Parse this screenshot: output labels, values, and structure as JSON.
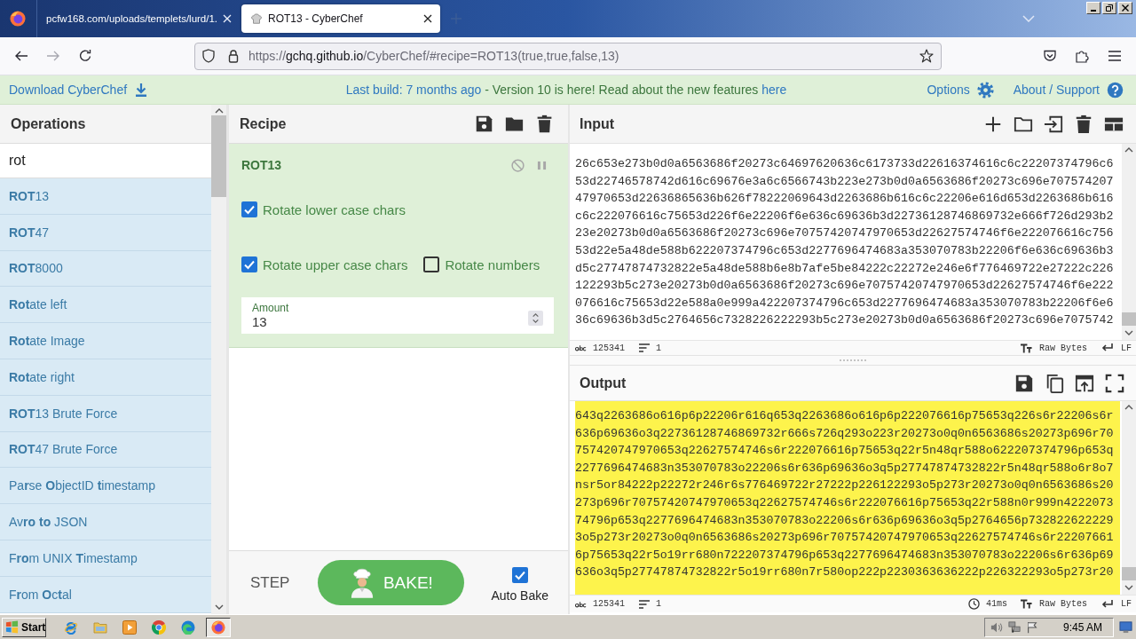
{
  "browser": {
    "tabs": [
      {
        "title": "pcfw168.com/uploads/templets/lurd/1.",
        "selected": false
      },
      {
        "title": "ROT13 - CyberChef",
        "selected": true
      }
    ],
    "url": {
      "scheme": "https://",
      "host": "gchq.github.io",
      "path": "/CyberChef/#recipe=ROT13(true,true,false,13)"
    }
  },
  "banner": {
    "download": "Download CyberChef",
    "build_link": "Last build: 7 months ago",
    "notice": "- Version 10 is here! Read about the new features",
    "notice_link": "here",
    "options": "Options",
    "about": "About / Support"
  },
  "operations": {
    "title": "Operations",
    "search": "rot",
    "items": [
      "**ROT**13",
      "**ROT**47",
      "**ROT**8000",
      "**Rot**ate left",
      "**Rot**ate Image",
      "**Rot**ate right",
      "**ROT**13 Brute Force",
      "**ROT**47 Brute Force",
      "Pa**r**se **O**bjectID **t**imestamp",
      "Av**ro** **to** JSON",
      "F**ro**m UNIX **T**imestamp",
      "F**r**om **O**c**t**al"
    ]
  },
  "recipe": {
    "title": "Recipe",
    "operation": {
      "name": "ROT13",
      "args": [
        {
          "kind": "checkbox",
          "label": "Rotate lower case chars",
          "checked": true
        },
        {
          "kind": "checkbox",
          "label": "Rotate upper case chars",
          "checked": true
        },
        {
          "kind": "checkbox",
          "label": "Rotate numbers",
          "checked": false
        },
        {
          "kind": "number",
          "label": "Amount",
          "value": "13"
        }
      ]
    },
    "step": "STEP",
    "bake": "BAKE!",
    "auto_bake": {
      "label": "Auto Bake",
      "checked": true
    }
  },
  "input": {
    "title": "Input",
    "lines": [
      "26c653e273b0d0a6563686f20273c64697620636c6173733d22616374616c6c22207374796c6",
      "53d22746578742d616c69676e3a6c6566743b223e273b0d0a6563686f20273c696e707574207",
      "47970653d22636865636b626f78222069643d2263686b616c6c22206e616d653d2263686b616",
      "c6c222076616c75653d226f6e22206f6e636c69636b3d22736128746869732e666f726d293b2",
      "23e20273b0d0a6563686f20273c696e70757420747970653d22627574746f6e222076616c756",
      "53d22e5a48de588b622207374796c653d2277696474683a353070783b22206f6e636c69636b3",
      "d5c27747874732822e5a48de588b6e8b7afe5be84222c22272e246e6f776469722e27222c226",
      "122293b5c273e20273b0d0a6563686f20273c696e70757420747970653d22627574746f6e222",
      "076616c75653d22e588a0e999a422207374796c653d2277696474683a353070783b22206f6e6",
      "36c69636b3d5c2764656c7328226222293b5c273e20273b0d0a6563686f20273c696e7075742"
    ],
    "length": "125341",
    "line_count": "1",
    "encoding": "Raw Bytes",
    "eol": "LF"
  },
  "output": {
    "title": "Output",
    "lines": [
      "643q2263686o616p6p22206r616q653q2263686o616p6p222076616p75653q226s6r22206s6r",
      "636p69636o3q22736128746869732r666s726q293o223r20273o0q0n6563686s20273p696r70",
      "757420747970653q22627574746s6r222076616p75653q22r5n48qr588o622207374796p653q",
      "2277696474683n353070783o22206s6r636p69636o3q5p27747874732822r5n48qr588o6r8o7",
      "nsr5or84222p22272r246r6s776469722r27222p226122293o5p273r20273o0q0n6563686s20",
      "273p696r70757420747970653q22627574746s6r222076616p75653q22r588n0r999n4222073",
      "74796p653q2277696474683n353070783o22206s6r636p69636o3q5p2764656p732822622229",
      "3o5p273r20273o0q0n6563686s20273p696r70757420747970653q22627574746s6r22207661",
      "6p75653q22r5o19rr680n722207374796p653q2277696474683n353070783o22206s6r636p69",
      "636o3q5p27747874732822r5o19rr680n7r580op222p2230363636222p226322293o5p273r20"
    ],
    "length": "125341",
    "line_count": "1",
    "time": "41ms",
    "encoding": "Raw Bytes",
    "eol": "LF"
  },
  "taskbar": {
    "start": "Start",
    "clock": "9:45 AM"
  }
}
